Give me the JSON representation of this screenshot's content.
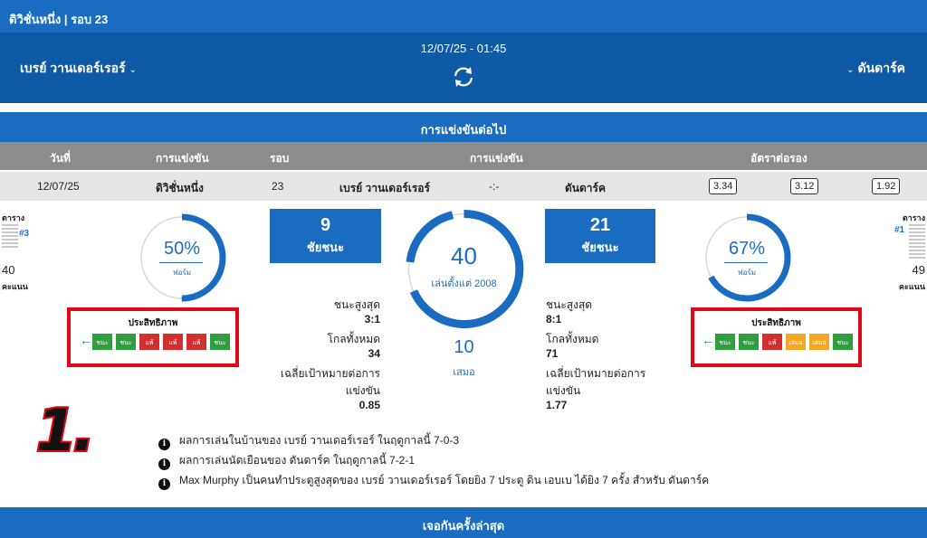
{
  "league": {
    "title": "ดิวิชั่นหนึ่ง | รอบ 23"
  },
  "match": {
    "datetime": "12/07/25 - 01:45",
    "home_team": "เบรย์ วานเดอร์เรอร์",
    "away_team": "ดันดาร์ค",
    "chevron_glyph": "⌄",
    "refresh_icon": "refresh-icon"
  },
  "next_match": {
    "title": "การแข่งขันต่อไป",
    "headers": {
      "date": "วันที่",
      "competition": "การแข่งขัน",
      "round": "รอบ",
      "match": "การแข่งขัน",
      "odds": "อัตราต่อรอง"
    },
    "row": {
      "date": "12/07/25",
      "competition": "ดิวิชั่นหนึ่ง",
      "round": "23",
      "home": "เบรย์ วานเดอร์เรอร์",
      "score": "-:-",
      "away": "ดันดาร์ค",
      "odds": [
        "3.34",
        "3.12",
        "1.92"
      ]
    }
  },
  "home": {
    "table_label": "ตาราง",
    "rank": "#3",
    "points": "40",
    "points_label": "คะแนน",
    "form_pct": "50%",
    "form_pct_value": 0.5,
    "form_label": "ฟอร์ม",
    "performance_title": "ประสิทธิภาพ",
    "form": [
      {
        "code": "W",
        "label": "ชนะ"
      },
      {
        "code": "W",
        "label": "ชนะ"
      },
      {
        "code": "L",
        "label": "แพ้"
      },
      {
        "code": "L",
        "label": "แพ้"
      },
      {
        "code": "L",
        "label": "แพ้"
      },
      {
        "code": "W",
        "label": "ชนะ"
      }
    ],
    "wins": "9",
    "wins_label": "ชัยชนะ",
    "biggest_win_label": "ชนะสูงสุด",
    "biggest_win": "3:1",
    "total_goals_label": "โกลทั้งหมด",
    "total_goals": "34",
    "avg_goals_label": "เฉลี่ยเป้าหมายต่อการแข่งขัน",
    "avg_goals": "0.85"
  },
  "away": {
    "table_label": "ตาราง",
    "rank": "#1",
    "points": "49",
    "points_label": "คะแนน",
    "form_pct": "67%",
    "form_pct_value": 0.67,
    "form_label": "ฟอร์ม",
    "performance_title": "ประสิทธิภาพ",
    "form": [
      {
        "code": "W",
        "label": "ชนะ"
      },
      {
        "code": "W",
        "label": "ชนะ"
      },
      {
        "code": "L",
        "label": "แพ้"
      },
      {
        "code": "D",
        "label": "เสมอ"
      },
      {
        "code": "D",
        "label": "เสมอ"
      },
      {
        "code": "W",
        "label": "ชนะ"
      }
    ],
    "wins": "21",
    "wins_label": "ชัยชนะ",
    "biggest_win_label": "ชนะสูงสุด",
    "biggest_win": "8:1",
    "total_goals_label": "โกลทั้งหมด",
    "total_goals": "71",
    "avg_goals_label": "เฉลี่ยเป้าหมายต่อการแข่งขัน",
    "avg_goals": "1.77"
  },
  "h2h": {
    "played": "40",
    "played_label": "เล่นตั้งแต่ 2008",
    "draws": "10",
    "draws_label": "เสมอ"
  },
  "annotation": {
    "number": "1."
  },
  "facts": [
    "ผลการเล่นในบ้านของ เบรย์ วานเดอร์เรอร์ ในฤดูกาลนี้ 7-0-3",
    "ผลการเล่นนัดเยือนของ ดันดาร์ค ในฤดูกาลนี้ 7-2-1",
    "Max Murphy เป็นคนทำประตูสูงสุดของ เบรย์ วานเดอร์เรอร์ โดยยิง 7 ประตู ดิน เอบเบ ได้ยิง 7 ครั้ง สำหรับ ดันดาร์ค"
  ],
  "info_icon_glyph": "i",
  "last_meetings": {
    "title": "เจอกันครั้งล่าสุด"
  },
  "colors": {
    "primary": "#1a6cc1",
    "header_dark": "#0f5aa5",
    "win": "#2e9e3e",
    "loss": "#d42f2f",
    "draw": "#f5a623",
    "highlight": "#e30613"
  }
}
